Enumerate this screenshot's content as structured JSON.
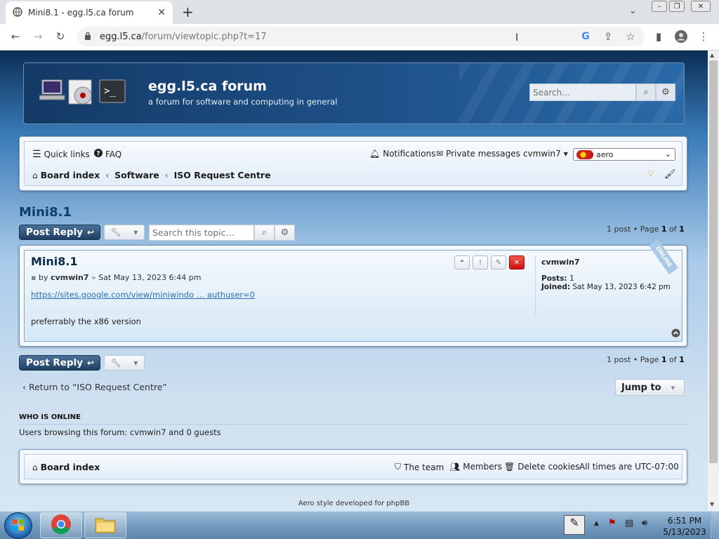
{
  "browser": {
    "tab_title": "Mini8.1 - egg.l5.ca forum",
    "url_host": "egg.l5.ca",
    "url_path": "/forum/viewtopic.php?t=17"
  },
  "header": {
    "site_name": "egg.l5.ca forum",
    "site_description": "a forum for software and computing in general",
    "search_placeholder": "Search…"
  },
  "nav": {
    "quick_links": "Quick links",
    "faq": "FAQ",
    "notifications": "Notifications",
    "private_messages": "Private messages",
    "username": "cvmwin7",
    "style_select": "aero",
    "breadcrumbs": [
      "Board index",
      "Software",
      "ISO Request Centre"
    ]
  },
  "topic": {
    "title": "Mini8.1",
    "post_reply": "Post Reply",
    "search_placeholder": "Search this topic…",
    "pagination": {
      "prefix": "1 post • Page",
      "current": "1",
      "of": "of",
      "total": "1"
    }
  },
  "post": {
    "title": "Mini8.1",
    "by": "by",
    "author": "cvmwin7",
    "date": "Sat May 13, 2023 6:44 pm",
    "link": "https://sites.google.com/view/miniwindo … authuser=0",
    "body": "preferrably the x86 version",
    "profile": {
      "username": "cvmwin7",
      "posts_label": "Posts:",
      "posts_value": "1",
      "joined_label": "Joined:",
      "joined_value": "Sat May 13, 2023 6:42 pm",
      "online_badge": "ONLINE"
    }
  },
  "bottom": {
    "return_link": "Return to “ISO Request Centre”",
    "jump_to": "Jump to"
  },
  "who_is_online": {
    "heading": "WHO IS ONLINE",
    "text": "Users browsing this forum: cvmwin7 and 0 guests"
  },
  "footer": {
    "board_index": "Board index",
    "the_team": "The team",
    "members": "Members",
    "delete_cookies": "Delete cookies",
    "timezone": "All times are UTC-07:00",
    "credit": "Aero style developed for phpBB"
  },
  "taskbar": {
    "time": "6:51 PM",
    "date": "5/13/2023"
  }
}
